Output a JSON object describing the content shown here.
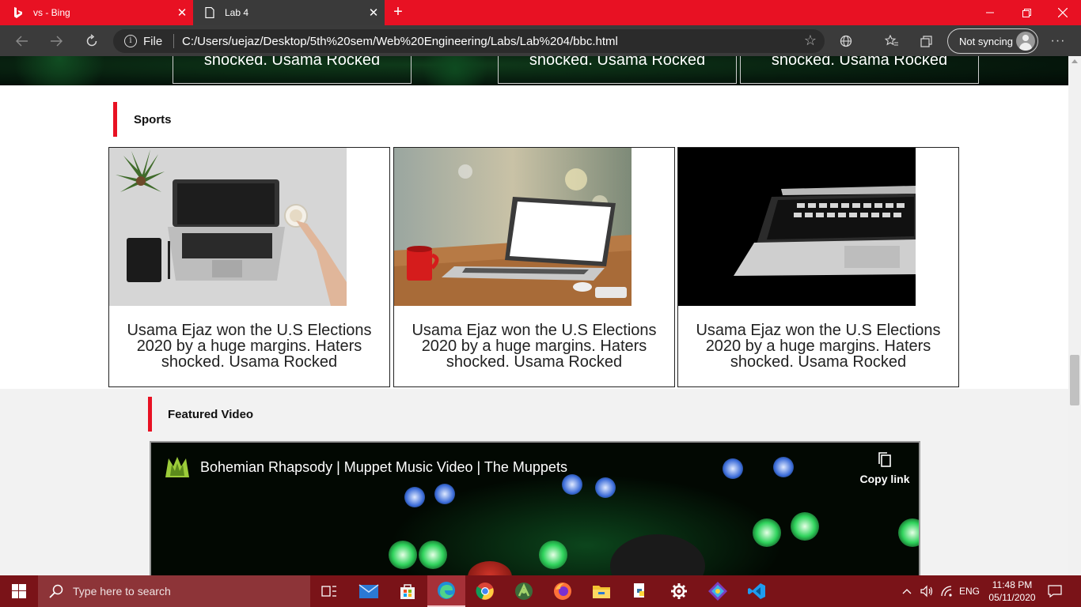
{
  "browser": {
    "tabs": [
      {
        "title": "vs - Bing",
        "close": "✕"
      },
      {
        "title": "Lab 4",
        "close": "✕"
      }
    ],
    "new_tab": "+",
    "address": {
      "protocol_label": "File",
      "url": "C:/Users/uejaz/Desktop/5th%20sem/Web%20Engineering/Labs/Lab%204/bbc.html"
    },
    "sync_label": "Not syncing",
    "more": "···"
  },
  "page": {
    "top_cards": [
      {
        "text": "shocked. Usama Rocked"
      },
      {
        "text": "shocked. Usama Rocked"
      },
      {
        "text": "shocked. Usama Rocked"
      }
    ],
    "sports": {
      "heading": "Sports",
      "cards": [
        {
          "caption": "Usama Ejaz won the U.S Elections 2020 by a huge margins. Haters shocked. Usama Rocked"
        },
        {
          "caption": "Usama Ejaz won the U.S Elections 2020 by a huge margins. Haters shocked. Usama Rocked"
        },
        {
          "caption": "Usama Ejaz won the U.S Elections 2020 by a huge margins. Haters shocked. Usama Rocked"
        }
      ]
    },
    "featured_video": {
      "heading": "Featured Video",
      "title": "Bohemian Rhapsody | Muppet Music Video | The Muppets",
      "copy_link": "Copy link"
    }
  },
  "taskbar": {
    "search_placeholder": "Type here to search",
    "language": "ENG",
    "time": "11:48 PM",
    "date": "05/11/2020"
  },
  "colors": {
    "accent_red": "#e81123",
    "toolbar_dark": "#3b3b3b",
    "taskbar": "#7a1318"
  }
}
